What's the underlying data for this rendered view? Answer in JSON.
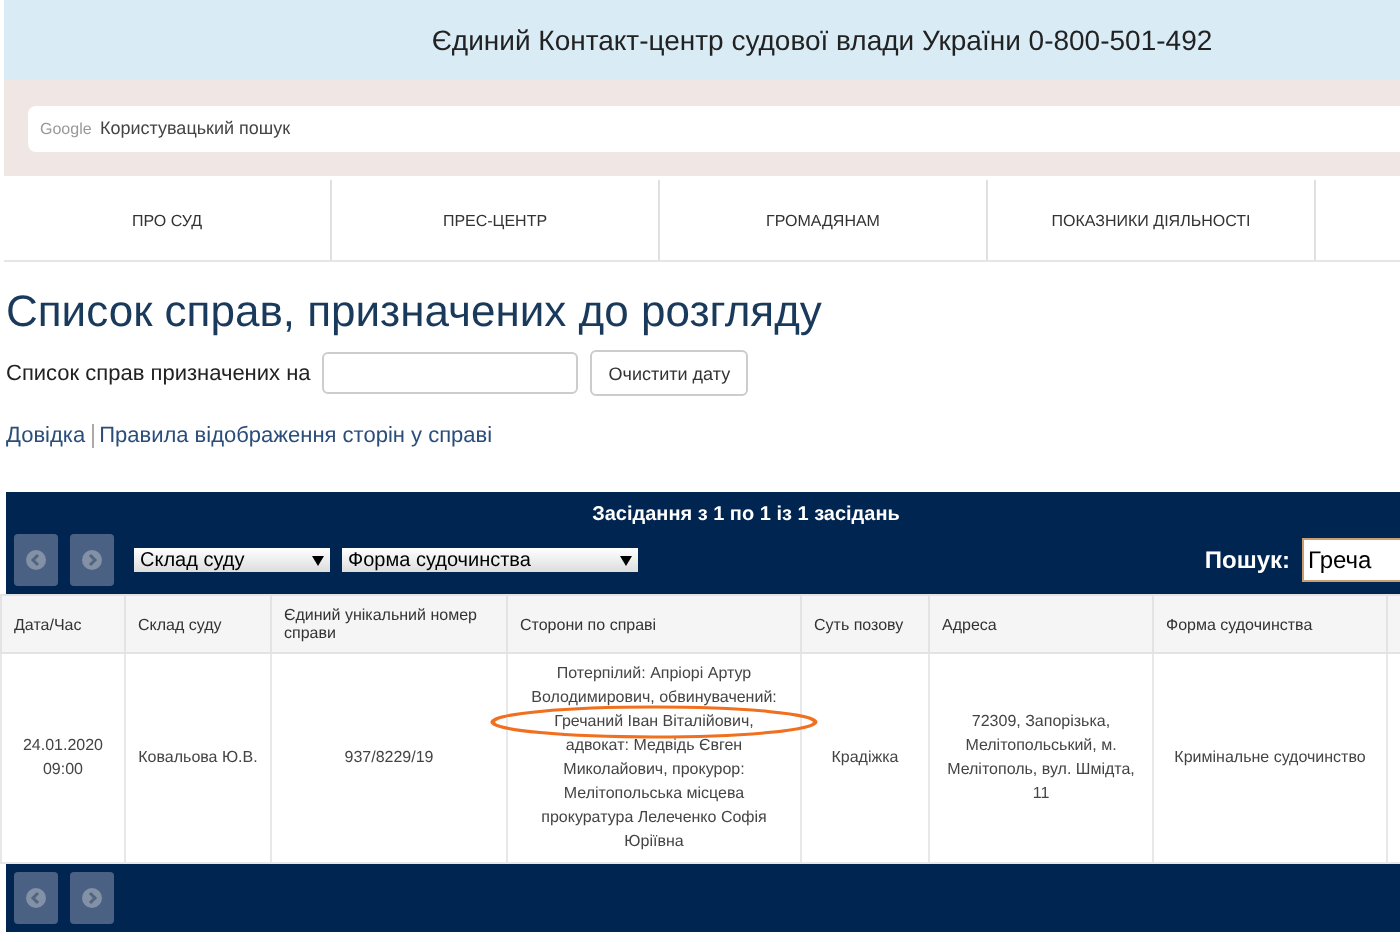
{
  "header": {
    "title": "Єдиний Контакт-центр судової влади України 0-800-501-492"
  },
  "site_search": {
    "brand": "Google",
    "placeholder": "Користувацький пошук"
  },
  "nav": [
    "ПРО СУД",
    "ПРЕС-ЦЕНТР",
    "ГРОМАДЯНАМ",
    "ПОКАЗНИКИ ДІЯЛЬНОСТІ"
  ],
  "page_title": "Список справ, призначених до розгляду",
  "date_filter": {
    "label": "Список справ призначених на",
    "button": "Очистити дату"
  },
  "links": [
    "Довідка",
    "Правила відображення сторін у справі"
  ],
  "table": {
    "info": "Засідання з 1 по 1 із 1 засідань",
    "filters": [
      "Склад суду",
      "Форма судочинства"
    ],
    "search": {
      "label": "Пошук:",
      "value": "Греча"
    },
    "columns": [
      "Дата/Час",
      "Склад суду",
      "Єдиний унікальний номер справи",
      "Сторони по справі",
      "Суть позову",
      "Адреса",
      "Форма судочинства"
    ],
    "rows": [
      {
        "datetime": "24.01.2020 09:00",
        "judge": "Ковальова Ю.В.",
        "case_number": "937/8229/19",
        "parties": [
          {
            "text": "Потерпілий: Апріорі Артур Володимирович, обвинувачений:",
            "circled": false
          },
          {
            "text": "Гречаний Іван Віталійович,",
            "circled": true
          },
          {
            "text": "адвокат: Медвідь Євген Миколайович, прокурор: Мелітопольська місцева прокуратура Лелеченко Софія Юріївна",
            "circled": false
          }
        ],
        "claim": "Крадіжка",
        "address": "72309, Запорізька, Мелітопольський, м. Мелітополь, вул. Шмідта, 11",
        "form": "Кримінальне судочинство"
      }
    ]
  }
}
